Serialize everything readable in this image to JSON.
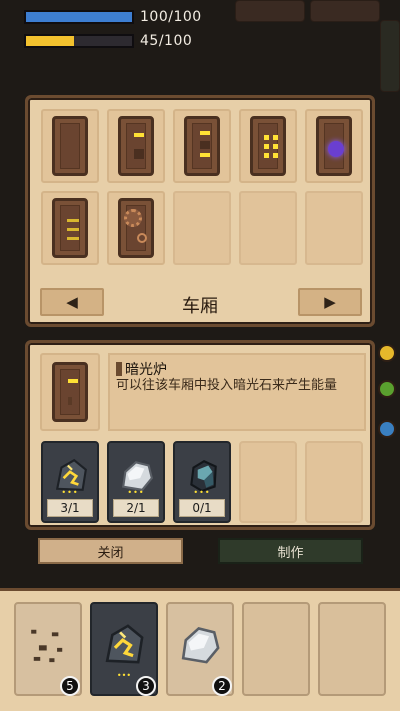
{
  "hud": {
    "health_text": "100/100",
    "health_fraction": 1.0,
    "health_color": "#3d7ed2",
    "energy_text": "45/100",
    "energy_fraction": 0.45,
    "energy_color": "#f2c12e"
  },
  "carriage_panel": {
    "title": "车厢",
    "prev_icon": "left-triangle-icon",
    "next_icon": "right-triangle-icon",
    "slots": [
      {
        "icon": "carriage-blank-icon"
      },
      {
        "icon": "carriage-single-light-icon"
      },
      {
        "icon": "carriage-double-light-icon"
      },
      {
        "icon": "carriage-grid-light-icon"
      },
      {
        "icon": "carriage-purple-orb-icon"
      },
      {
        "icon": "carriage-bars-icon"
      },
      {
        "icon": "carriage-gear-icon"
      },
      {
        "icon": null
      },
      {
        "icon": null
      },
      {
        "icon": null
      }
    ]
  },
  "detail_panel": {
    "item_name": "暗光炉",
    "description": "可以往该车厢中投入暗光石来产生能量",
    "materials": [
      {
        "icon": "gold-ore-icon",
        "count": "3/1"
      },
      {
        "icon": "silver-ore-icon",
        "count": "2/1"
      },
      {
        "icon": "teal-crystal-ore-icon",
        "count": "0/1"
      },
      {
        "icon": null,
        "count": null
      },
      {
        "icon": null,
        "count": null
      }
    ],
    "close_label": "关闭",
    "craft_label": "制作"
  },
  "inventory": {
    "slots": [
      {
        "icon": "dirt-pebbles-icon",
        "count": "5"
      },
      {
        "icon": "gold-ore-icon",
        "count": "3"
      },
      {
        "icon": "silver-ore-icon",
        "count": "2"
      },
      {
        "icon": null,
        "count": null
      },
      {
        "icon": null,
        "count": null
      }
    ]
  }
}
